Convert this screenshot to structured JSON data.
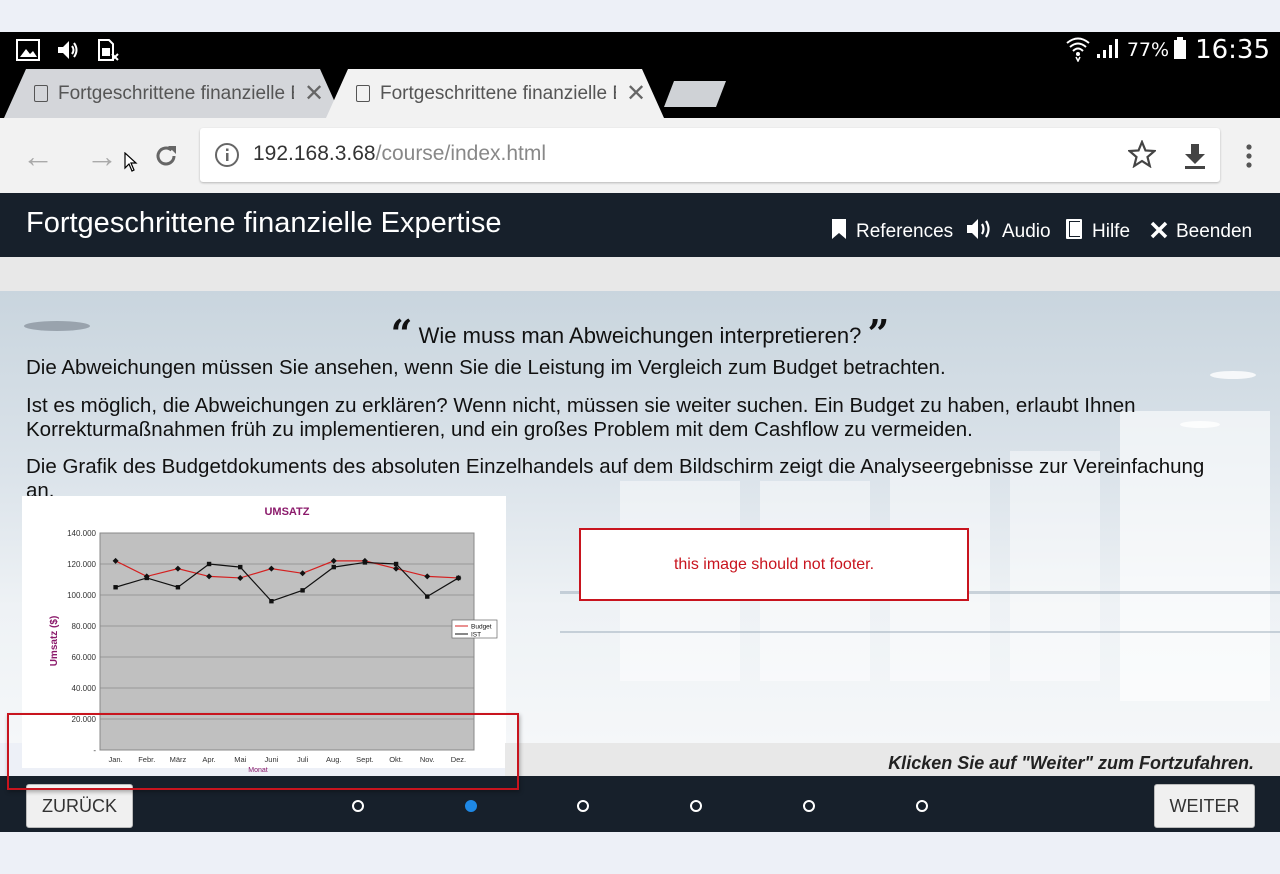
{
  "status_bar": {
    "left_icons": [
      "image-icon",
      "volume-icon",
      "sim-icon"
    ],
    "battery": "77%",
    "time": "16:35"
  },
  "tabs": [
    {
      "label": "Fortgeschrittene finanzielle Expertise",
      "active": false
    },
    {
      "label": "Fortgeschrittene finanzielle Expertise",
      "active": true
    }
  ],
  "toolbar": {
    "url_host": "192.168.3.68",
    "url_path": "/course/index.html"
  },
  "header": {
    "title": "Fortgeschrittene finanzielle Expertise",
    "nav": {
      "references": "References",
      "audio": "Audio",
      "help": "Hilfe",
      "exit": "Beenden"
    }
  },
  "content": {
    "question": "Wie muss man Abweichungen interpretieren?",
    "paragraphs": [
      "Die Abweichungen müssen Sie ansehen, wenn Sie die Leistung im Vergleich zum Budget betrachten.",
      "Ist es möglich, die Abweichungen zu erklären? Wenn nicht, müssen sie weiter suchen. Ein Budget zu haben, erlaubt Ihnen Korrekturmaßnahmen früh zu implementieren, und ein großes Problem mit dem Cashflow zu vermeiden.",
      "Die Grafik des Budgetdokuments des absoluten Einzelhandels auf dem Bildschirm zeigt die Analyseergebnisse zur Vereinfachung an."
    ],
    "note": "this image should not footer.",
    "continue_hint": "Klicken Sie auf \"Weiter\" zum Fortzufahren."
  },
  "chart_data": {
    "type": "line",
    "title": "UMSATZ",
    "xlabel": "Monat",
    "ylabel": "Umsatz ($)",
    "categories": [
      "Jan.",
      "Febr.",
      "März",
      "Apr.",
      "Mai",
      "Juni",
      "Juli",
      "Aug.",
      "Sept.",
      "Okt.",
      "Nov.",
      "Dez."
    ],
    "y_ticks": [
      "-",
      "20.000",
      "40.000",
      "60.000",
      "80.000",
      "100.000",
      "120.000",
      "140.000"
    ],
    "ylim": [
      0,
      140000
    ],
    "grid": true,
    "legend": "right",
    "series": [
      {
        "name": "Budget",
        "values": [
          122000,
          112000,
          117000,
          112000,
          111000,
          117000,
          114000,
          122000,
          122000,
          117000,
          112000,
          111000
        ],
        "color": "#d42020",
        "marker": "diamond"
      },
      {
        "name": "IST",
        "values": [
          105000,
          111000,
          105000,
          120000,
          118000,
          96000,
          103000,
          118000,
          121000,
          120000,
          99000,
          111000
        ],
        "color": "#111111",
        "marker": "square"
      }
    ],
    "colors": {
      "plot_bg": "#c0c0c0",
      "title": "#8b1a6b"
    }
  },
  "footer": {
    "back_label": "ZURÜCK",
    "next_label": "WEITER",
    "page_count": 6,
    "active_page": 2
  },
  "colors": {
    "header_bg": "#17202b",
    "accent": "#1e88e5",
    "note_red": "#c8141e"
  }
}
